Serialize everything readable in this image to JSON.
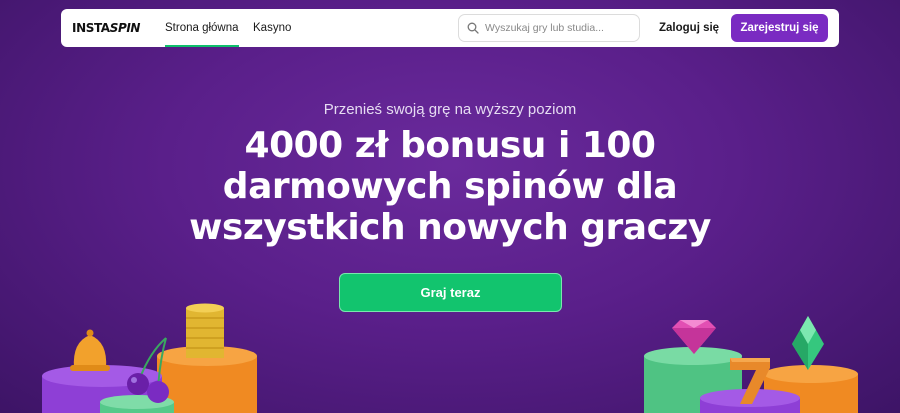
{
  "header": {
    "logo_text_a": "INSTA",
    "logo_text_b": "SPIN",
    "nav": [
      {
        "label": "Strona główna",
        "active": true
      },
      {
        "label": "Kasyno",
        "active": false
      }
    ],
    "search_placeholder": "Wyszukaj gry lub studia...",
    "login_label": "Zaloguj się",
    "register_label": "Zarejestruj się"
  },
  "hero": {
    "tagline": "Przenieś swoją grę na wyższy poziom",
    "headline_line1": "4000 zł bonusu i 100",
    "headline_line2": "darmowych spinów dla",
    "headline_line3": "wszystkich nowych graczy",
    "cta_label": "Graj teraz"
  },
  "colors": {
    "background": "#5a1f8a",
    "accent_green": "#12c46e",
    "register_purple": "#7a2bc2",
    "pedestal_purple": "#8b3fd1",
    "pedestal_orange": "#f4932a",
    "pedestal_green": "#5bd08a"
  },
  "icons": [
    "search-icon",
    "bell-icon",
    "cherries-icon",
    "coin-stack-icon",
    "pink-gem-icon",
    "green-gem-icon",
    "seven-icon"
  ]
}
